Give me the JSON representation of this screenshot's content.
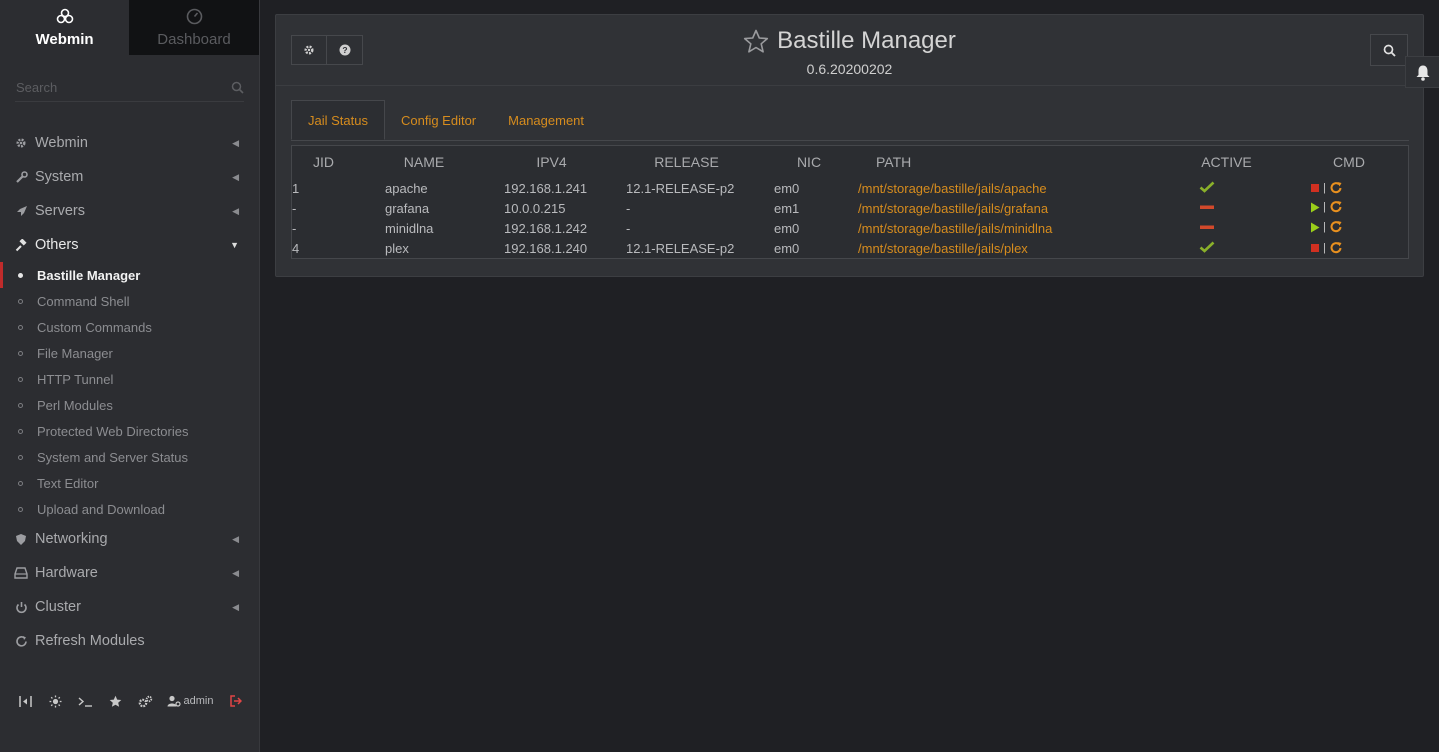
{
  "sidebar": {
    "tabs": [
      {
        "label": "Webmin",
        "icon": "webmin-logo-icon"
      },
      {
        "label": "Dashboard",
        "icon": "dashboard-gauge-icon"
      }
    ],
    "search_placeholder": "Search",
    "categories_top": [
      {
        "label": "Webmin",
        "icon": "gear-icon"
      },
      {
        "label": "System",
        "icon": "wrench-icon"
      },
      {
        "label": "Servers",
        "icon": "rocket-icon"
      }
    ],
    "open_category": {
      "label": "Others",
      "icon": "gavel-icon"
    },
    "sub_items": [
      {
        "label": "Bastille Manager"
      },
      {
        "label": "Command Shell"
      },
      {
        "label": "Custom Commands"
      },
      {
        "label": "File Manager"
      },
      {
        "label": "HTTP Tunnel"
      },
      {
        "label": "Perl Modules"
      },
      {
        "label": "Protected Web Directories"
      },
      {
        "label": "System and Server Status"
      },
      {
        "label": "Text Editor"
      },
      {
        "label": "Upload and Download"
      }
    ],
    "categories_bottom": [
      {
        "label": "Networking",
        "icon": "shield-icon"
      },
      {
        "label": "Hardware",
        "icon": "hdd-icon"
      },
      {
        "label": "Cluster",
        "icon": "power-icon"
      },
      {
        "label": "Refresh Modules",
        "icon": "refresh-icon"
      }
    ],
    "bottom_bar": {
      "user_label": "admin"
    }
  },
  "header": {
    "title": "Bastille Manager",
    "version": "0.6.20200202"
  },
  "tabs": [
    "Jail Status",
    "Config Editor",
    "Management"
  ],
  "table": {
    "columns": [
      "JID",
      "NAME",
      "IPV4",
      "RELEASE",
      "NIC",
      "PATH",
      "ACTIVE",
      "CMD"
    ],
    "rows": [
      {
        "jid": "1",
        "name": "apache",
        "ipv4": "192.168.1.241",
        "release": "12.1-RELEASE-p2",
        "nic": "em0",
        "path": "/mnt/storage/bastille/jails/apache",
        "active": true
      },
      {
        "jid": "-",
        "name": "grafana",
        "ipv4": "10.0.0.215",
        "release": "-",
        "nic": "em1",
        "path": "/mnt/storage/bastille/jails/grafana",
        "active": false
      },
      {
        "jid": "-",
        "name": "minidlna",
        "ipv4": "192.168.1.242",
        "release": "-",
        "nic": "em0",
        "path": "/mnt/storage/bastille/jails/minidlna",
        "active": false
      },
      {
        "jid": "4",
        "name": "plex",
        "ipv4": "192.168.1.240",
        "release": "12.1-RELEASE-p2",
        "nic": "em0",
        "path": "/mnt/storage/bastille/jails/plex",
        "active": true
      }
    ]
  },
  "colors": {
    "accent": "#d68c1e",
    "active_check": "#8ab02a",
    "inactive_dash": "#d2492b",
    "stop": "#d03021",
    "start": "#9acd1a",
    "selected_marker": "#c02b2b"
  }
}
